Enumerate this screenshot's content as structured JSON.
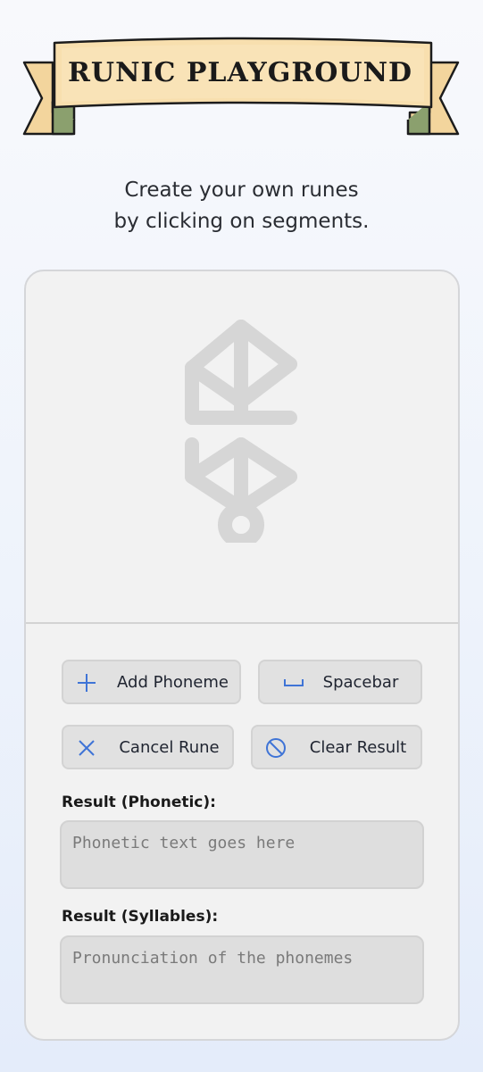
{
  "header": {
    "title": "RUNIC PLAYGROUND"
  },
  "intro": {
    "line1": "Create your own runes",
    "line2": "by clicking on segments."
  },
  "controls": {
    "add_phoneme": {
      "label": "Add Phoneme",
      "icon": "plus-icon"
    },
    "spacebar": {
      "label": "Spacebar",
      "icon": "space-icon"
    },
    "cancel_rune": {
      "label": "Cancel Rune",
      "icon": "x-icon"
    },
    "clear_result": {
      "label": "Clear Result",
      "icon": "no-entry-icon"
    }
  },
  "results": {
    "phonetic": {
      "label": "Result (Phonetic):",
      "placeholder": "Phonetic text goes here"
    },
    "syllables": {
      "label": "Result (Syllables):",
      "placeholder": "Pronunciation of the phonemes"
    }
  },
  "colors": {
    "accent_icon": "#3f74d6",
    "banner_fill": "#f6dca8",
    "banner_ribbon": "#8ba06e",
    "rune_segment": "#d6d6d6"
  }
}
